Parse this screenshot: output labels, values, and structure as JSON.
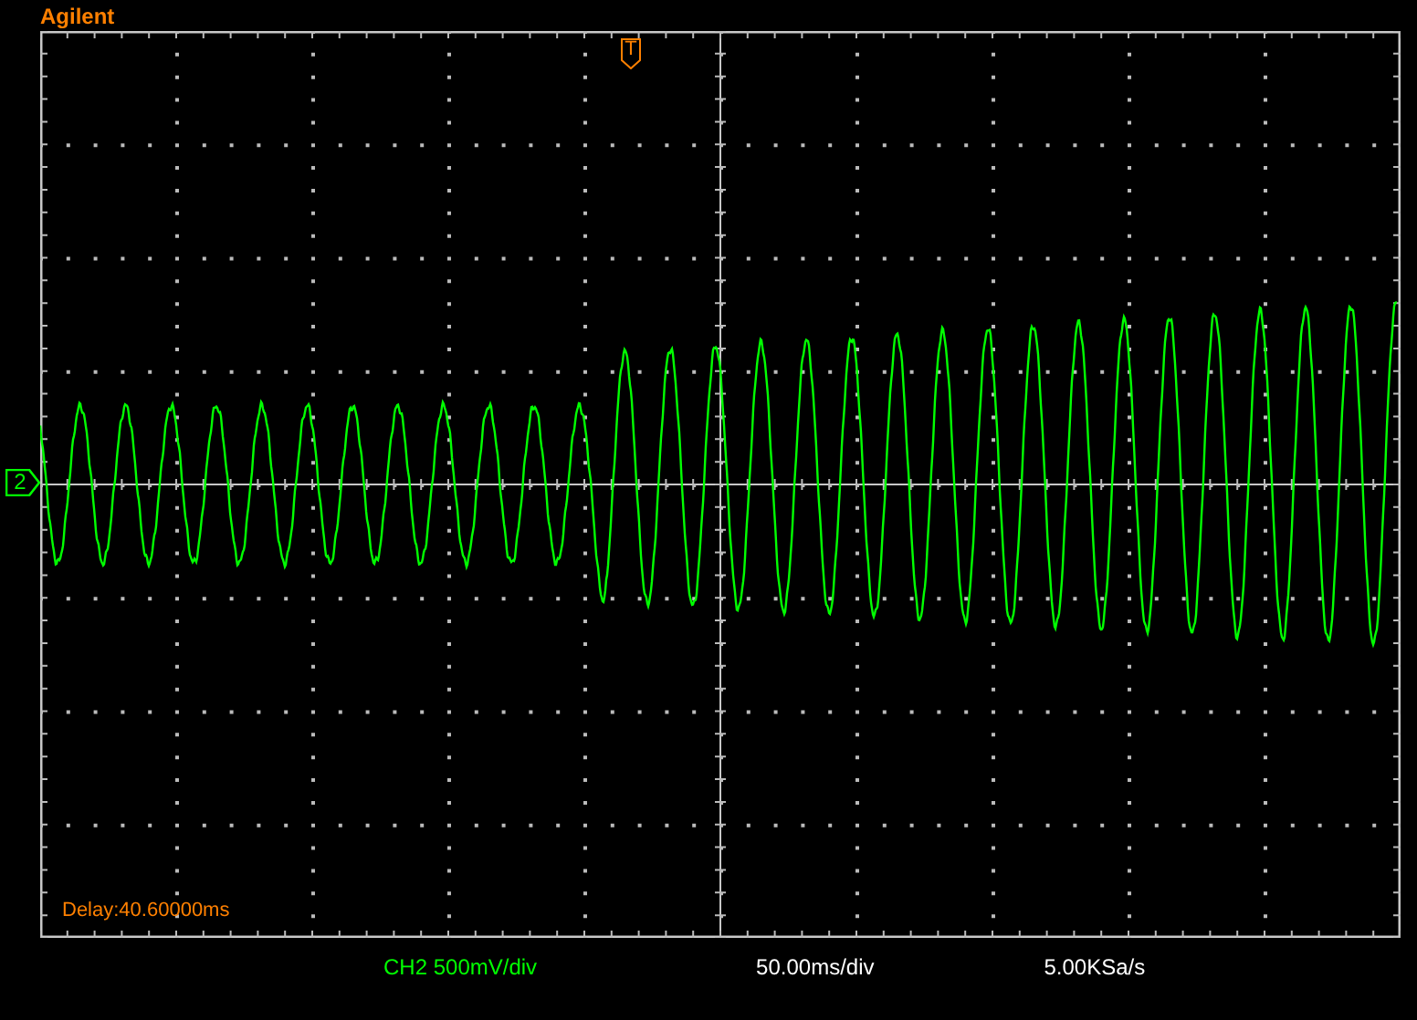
{
  "brand": "Agilent",
  "trigger_marker": "T",
  "channel_marker": {
    "label": "2",
    "color": "#00ff00"
  },
  "delay": "Delay:40.60000ms",
  "status_bar": [
    {
      "kind": "channel",
      "text": "CH2 500mV/div"
    },
    {
      "kind": "timebase",
      "text": "50.00ms/div"
    },
    {
      "kind": "sample_rate",
      "text": "5.00KSa/s"
    }
  ]
}
